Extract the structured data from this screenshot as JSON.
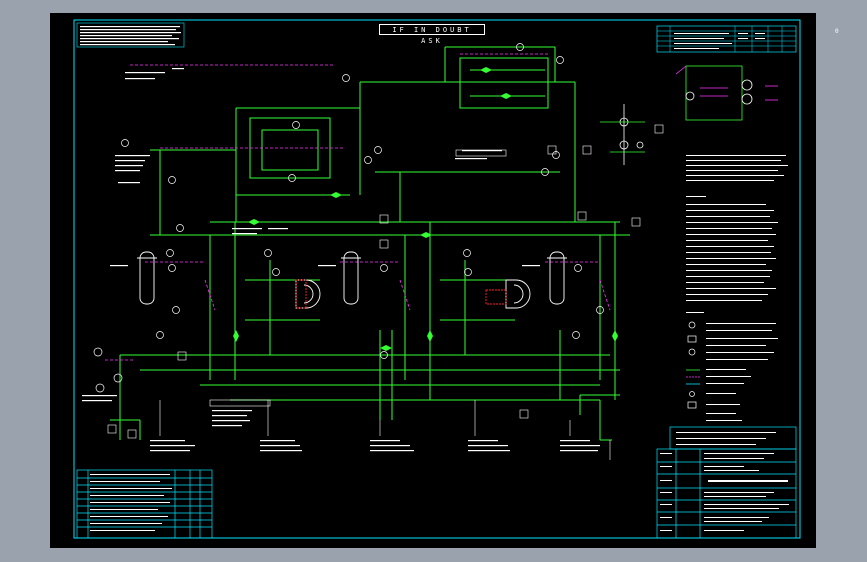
{
  "drawing": {
    "top_label": "IF IN DOUBT ASK",
    "corner_mark": "0"
  },
  "colors": {
    "background": "#000000",
    "frame": "#00e5ff",
    "process_line": "#33ff33",
    "signal_line": "#ff33ff",
    "annotation": "#ffffff",
    "highlight": "#ff2222",
    "outer": "#9aa3ad"
  },
  "icons": [
    "valve-icon",
    "instrument-bubble-icon",
    "vessel-icon",
    "pump-icon",
    "heat-exchanger-icon"
  ]
}
